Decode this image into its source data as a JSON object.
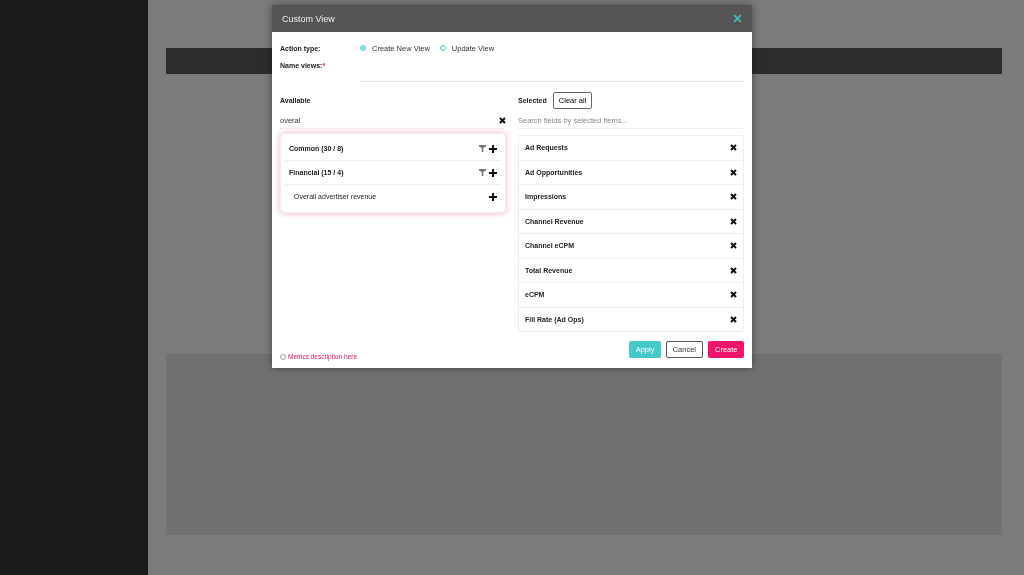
{
  "dialog": {
    "title": "Custom View",
    "action_type": {
      "label": "Action type:",
      "options": [
        {
          "label": "Create New View",
          "selected": true
        },
        {
          "label": "Update View",
          "selected": false
        }
      ]
    },
    "name_field": {
      "label": "Name views:",
      "required_mark": "*"
    },
    "available": {
      "label": "Available",
      "search_value": "overal",
      "groups": [
        {
          "label": "Common (30 / 8)"
        },
        {
          "label": "Financial (15 / 4)",
          "children": [
            {
              "label": "Overall advertiser revenue"
            }
          ]
        }
      ]
    },
    "selected": {
      "label": "Selected",
      "clear_button": "Clear all",
      "search_placeholder": "Search fields by selected items...",
      "items": [
        {
          "label": "Ad Requests"
        },
        {
          "label": "Ad Opportunities"
        },
        {
          "label": "Impressions"
        },
        {
          "label": "Channel Revenue"
        },
        {
          "label": "Channel eCPM"
        },
        {
          "label": "Total Revenue"
        },
        {
          "label": "eCPM"
        },
        {
          "label": "Fill Rate (Ad Ops)"
        }
      ]
    },
    "metrics_link": "Metrics description here",
    "buttons": [
      {
        "label": "Apply",
        "kind": "apply"
      },
      {
        "label": "Cancel",
        "kind": "cancel"
      },
      {
        "label": "Create",
        "kind": "create"
      }
    ]
  }
}
